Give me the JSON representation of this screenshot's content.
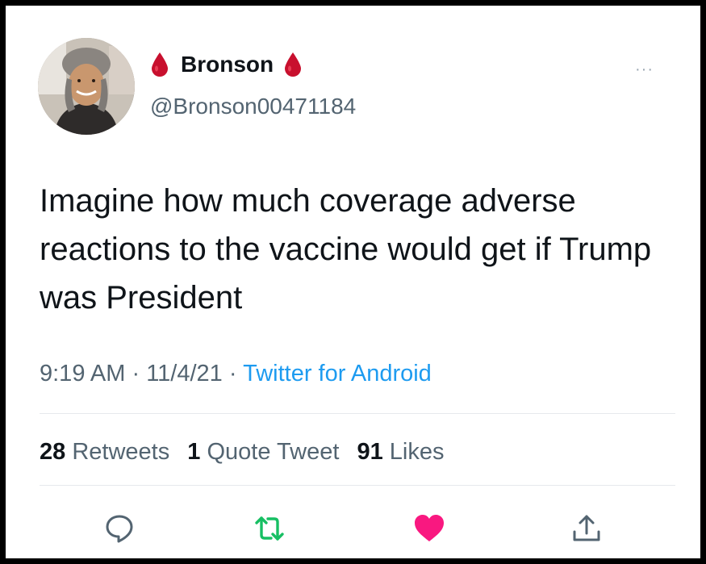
{
  "user": {
    "display_name": "Bronson",
    "handle": "@Bronson00471184",
    "avatar_icon": "profile-photo"
  },
  "tweet": {
    "text": "Imagine how much coverage adverse reactions to the vaccine would get if Trump was President",
    "time": "9:19 AM",
    "date": "11/4/21",
    "source": "Twitter for Android",
    "sep": "·"
  },
  "stats": {
    "retweets_count": "28",
    "retweets_label": "Retweets",
    "quotes_count": "1",
    "quotes_label": "Quote Tweet",
    "likes_count": "91",
    "likes_label": "Likes"
  },
  "more_label": "···",
  "colors": {
    "blood_drop": "#c8102e",
    "link": "#1d9bf0",
    "retweet": "#17bf63",
    "like": "#f91880",
    "muted": "#536471"
  },
  "icons": [
    "reply-icon",
    "retweet-icon",
    "like-icon",
    "share-icon",
    "more-icon",
    "blood-drop-icon"
  ]
}
